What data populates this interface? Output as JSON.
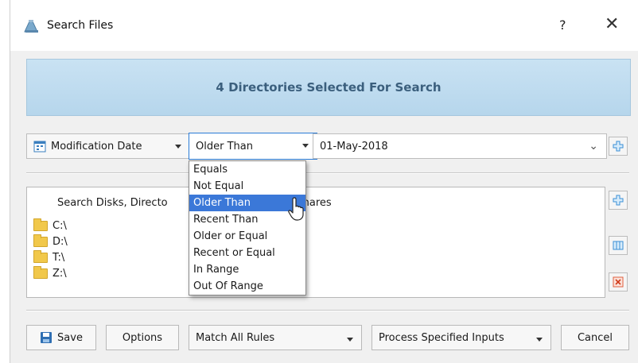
{
  "window": {
    "title": "Search Files",
    "help_label": "?",
    "close_label": "✕",
    "icon": "search-files-app-icon"
  },
  "banner": {
    "text": "4 Directories Selected For Search"
  },
  "rule": {
    "field_label": "Modification Date",
    "field_icon": "calendar-field-icon",
    "operator_value": "Older Than",
    "date_value": "01-May-2018",
    "add_rule_icon": "plus-icon"
  },
  "operator_options": [
    {
      "label": "Equals",
      "selected": false
    },
    {
      "label": "Not Equal",
      "selected": false
    },
    {
      "label": "Older Than",
      "selected": true
    },
    {
      "label": "Recent Than",
      "selected": false
    },
    {
      "label": "Older or Equal",
      "selected": false
    },
    {
      "label": "Recent or Equal",
      "selected": false
    },
    {
      "label": "In Range",
      "selected": false
    },
    {
      "label": "Out Of Range",
      "selected": false
    }
  ],
  "inputs_list": {
    "header_left": "Search Disks, Directo",
    "header_right": "hares",
    "items": [
      {
        "label": "C:\\"
      },
      {
        "label": "D:\\"
      },
      {
        "label": "T:\\"
      },
      {
        "label": "Z:\\"
      }
    ]
  },
  "side_buttons": [
    "plus-icon",
    "columns-icon",
    "remove-icon"
  ],
  "buttons": {
    "save": "Save",
    "options": "Options",
    "match_mode": "Match All Rules",
    "process_mode": "Process Specified Inputs",
    "cancel": "Cancel"
  },
  "colors": {
    "banner_bg": "#c9e2f3",
    "banner_text": "#3b5f7d",
    "selection": "#3b78d8",
    "accent_icon": "#3a8fd6"
  }
}
